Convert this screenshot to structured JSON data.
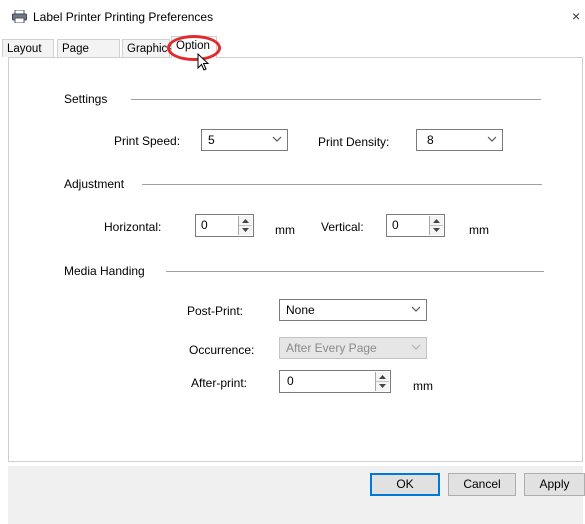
{
  "window": {
    "title": "Label Printer Printing Preferences",
    "close_glyph": "×",
    "icon": "printer-icon"
  },
  "tabs": [
    {
      "label": "Layout"
    },
    {
      "label": "Page Setup"
    },
    {
      "label": "Graphics"
    },
    {
      "label": "Option",
      "active": true
    }
  ],
  "settings": {
    "title": "Settings",
    "print_speed_label": "Print Speed:",
    "print_speed_value": "5",
    "print_density_label": "Print Density:",
    "print_density_value": "8"
  },
  "adjustment": {
    "title": "Adjustment",
    "horizontal_label": "Horizontal:",
    "horizontal_value": "0",
    "horizontal_unit": "mm",
    "vertical_label": "Vertical:",
    "vertical_value": "0",
    "vertical_unit": "mm"
  },
  "media": {
    "title": "Media Handing",
    "post_print_label": "Post-Print:",
    "post_print_value": "None",
    "occurrence_label": "Occurrence:",
    "occurrence_value": "After Every Page",
    "after_print_label": "After-print:",
    "after_print_value": "0",
    "after_print_unit": "mm"
  },
  "buttons": {
    "ok": "OK",
    "cancel": "Cancel",
    "apply": "Apply"
  },
  "colors": {
    "highlight_circle": "#e02b2b",
    "default_button_border": "#0078d7"
  }
}
